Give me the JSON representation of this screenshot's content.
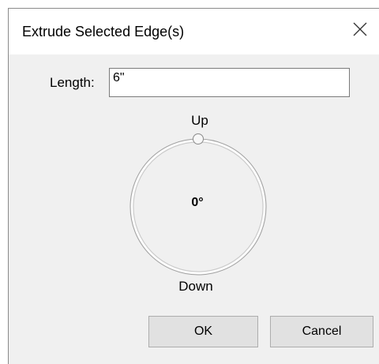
{
  "dialog": {
    "title": "Extrude Selected Edge(s)",
    "close_icon": "close-icon"
  },
  "length": {
    "label": "Length:",
    "value": "6\""
  },
  "direction_dial": {
    "top_label": "Up",
    "bottom_label": "Down",
    "angle_text": "0°",
    "angle_degrees": 0
  },
  "buttons": {
    "ok_label": "OK",
    "cancel_label": "Cancel"
  }
}
